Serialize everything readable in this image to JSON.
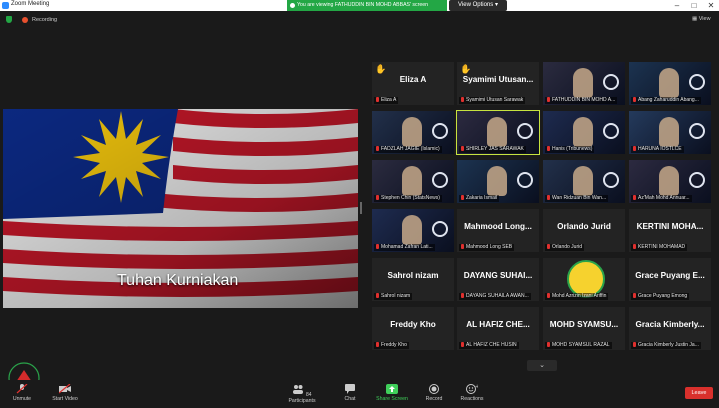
{
  "window": {
    "title": "Zoom Meeting"
  },
  "share": {
    "banner": "You are viewing FATHUDDIN BIN MOHD ABBAS' screen",
    "view_options": "View Options"
  },
  "recording": {
    "label": "Recording"
  },
  "view": {
    "label": "View"
  },
  "main": {
    "caption": "Tuhan Kurniakan"
  },
  "tiles": [
    {
      "name": "Eliza A",
      "foot": "Eliza A",
      "hand": true,
      "video": false
    },
    {
      "name": "Syamimi  Utusan...",
      "foot": "Syamimi Utusan Sarawak",
      "hand": true,
      "video": false
    },
    {
      "name": "",
      "foot": "FATHUDDIN BIN MOHD A...",
      "hand": false,
      "video": true
    },
    {
      "name": "",
      "foot": "Abang Zaharuddin Abang...",
      "hand": false,
      "video": true
    },
    {
      "name": "",
      "foot": "FADZLAH JAGIE (Islamic)",
      "hand": false,
      "video": true
    },
    {
      "name": "",
      "foot": "SHIRLEY JAS SARAWAK",
      "hand": false,
      "video": true
    },
    {
      "name": "",
      "foot": "Hanis (Tribunews)",
      "hand": false,
      "video": true
    },
    {
      "name": "",
      "foot": "HARUNA IOSTLCE",
      "hand": false,
      "video": true
    },
    {
      "name": "",
      "foot": "Stephen Chin (StatsNews)",
      "hand": false,
      "video": true
    },
    {
      "name": "",
      "foot": "Zakaria Ismail",
      "hand": false,
      "video": true
    },
    {
      "name": "",
      "foot": "Wan Ridzuan Bin Wan...",
      "hand": false,
      "video": true
    },
    {
      "name": "",
      "foot": "Az'Mah Mohd Annuar...",
      "hand": false,
      "video": true
    },
    {
      "name": "",
      "foot": "Mohamad Zafran Lati...",
      "hand": false,
      "video": true
    },
    {
      "name": "Mahmood Long...",
      "foot": "Mahmood Long SEB",
      "hand": false,
      "video": false
    },
    {
      "name": "Orlando Jurid",
      "foot": "Orlando Jurid",
      "hand": false,
      "video": false
    },
    {
      "name": "KERTINI MOHA...",
      "foot": "KERTINI MOHAMAD",
      "hand": false,
      "video": false
    },
    {
      "name": "Sahrol nizam",
      "foot": "Sahrol nizam",
      "hand": false,
      "video": false
    },
    {
      "name": "DAYANG SUHAI...",
      "foot": "DAYANG SUHAILA AWAN...",
      "hand": false,
      "video": false
    },
    {
      "name": "",
      "foot": "Mohd Azrizin Izani Ariffin",
      "hand": false,
      "video": false
    },
    {
      "name": "Grace Puyang E...",
      "foot": "Grace Puyang Emong",
      "hand": false,
      "video": false
    },
    {
      "name": "Freddy Kho",
      "foot": "Freddy Kho",
      "hand": false,
      "video": false
    },
    {
      "name": "AL HAFIZ CHE...",
      "foot": "AL HAFIZ CHE HUSIN",
      "hand": false,
      "video": false
    },
    {
      "name": "MOHD SYAMSU...",
      "foot": "MOHD SYAMSUL RAZAL",
      "hand": false,
      "video": false
    },
    {
      "name": "Gracia Kimberly...",
      "foot": "Gracia Kimberly Justin Ja...",
      "hand": false,
      "video": false
    }
  ],
  "toolbar": {
    "unmute": "Unmute",
    "start_video": "Start Video",
    "participants": "Participants",
    "participants_count": "84",
    "chat": "Chat",
    "share_screen": "Share Screen",
    "record": "Record",
    "reactions": "Reactions",
    "leave": "Leave"
  },
  "colors": {
    "active_speaker": "#c7e33f",
    "share_green": "#23a745",
    "leave_red": "#d9302c"
  }
}
